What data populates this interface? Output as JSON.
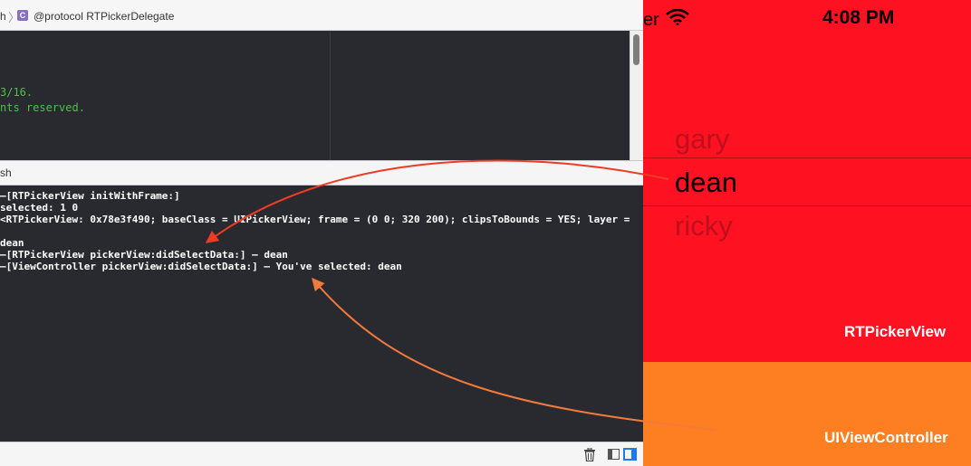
{
  "jumpbar": {
    "prev_crumb": "h",
    "separator": "〉",
    "proto_icon_letter": "C",
    "crumb": "@protocol RTPickerDelegate"
  },
  "editor": {
    "lines": [
      "3/16.",
      "nts reserved."
    ]
  },
  "debugbar": {
    "label": "sh"
  },
  "console": {
    "lines": [
      "–[RTPickerView initWithFrame:]",
      "selected: 1 0",
      "<RTPickerView: 0x78e3f490; baseClass = UIPickerView; frame = (0 0; 320 200); clipsToBounds = YES; layer =",
      "",
      "dean",
      "–[RTPickerView pickerView:didSelectData:] – dean",
      "–[ViewController pickerView:didSelectData:] – You've selected: dean"
    ]
  },
  "simulator": {
    "carrier": "er",
    "time": "4:08 PM",
    "picker_items": [
      "gary",
      "dean",
      "ricky"
    ],
    "selected_item": "dean",
    "picker_label": "RTPickerView",
    "vc_label": "UIViewController",
    "colors": {
      "picker_bg": "#fe1120",
      "vc_bg": "#fe7f21"
    }
  },
  "icons": {
    "trash": "trash-icon",
    "wifi": "wifi-icon",
    "left_pane": "hide-left-pane-icon",
    "right_pane": "show-right-pane-icon"
  }
}
